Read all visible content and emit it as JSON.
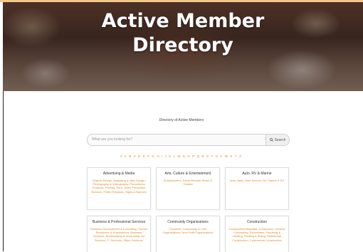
{
  "hero": {
    "title": "Active Member\nDirectory"
  },
  "intro": "Directory of Active Members",
  "search": {
    "placeholder": "What are you looking for?",
    "button_label": "Search",
    "icon": "search-icon"
  },
  "alphabet": [
    "#",
    "A",
    "B",
    "C",
    "D",
    "E",
    "F",
    "G",
    "H",
    "I",
    "J",
    "K",
    "L",
    "M",
    "N",
    "O",
    "P",
    "Q",
    "R",
    "S",
    "T",
    "U",
    "V",
    "W",
    "X",
    "Y",
    "Z"
  ],
  "categories": [
    {
      "name": "Advertising & Media",
      "items": "Graphic Design, Marketing & Web Design, Photography & Videography, Promotional Products, Printing, Print, Video Production Services, Public Relations, Signs & Banners"
    },
    {
      "name": "Arts, Culture & Entertainment",
      "items": "Entertainment, Event Rentals, Music & Theatre"
    },
    {
      "name": "Auto, RV & Marine",
      "items": "Auto Sales, Auto Service, RV, Marine & RV"
    },
    {
      "name": "Business & Professional Services",
      "items": "Business Development & Consulting, Human Resources & Employment, Business Services, Bookkeeping & Accounting, Ad Services, IT Services, Office Solutions"
    },
    {
      "name": "Community Organizations",
      "items": "Churches, Community & Civic Organizations, Non-Profit Organizations"
    },
    {
      "name": "Construction",
      "items": "Construction Materials, Contractors, General Contracting, Electricians, Plumbing & Heating, Roofing & Siding, Residential Construction, Commercial Construction"
    }
  ]
}
